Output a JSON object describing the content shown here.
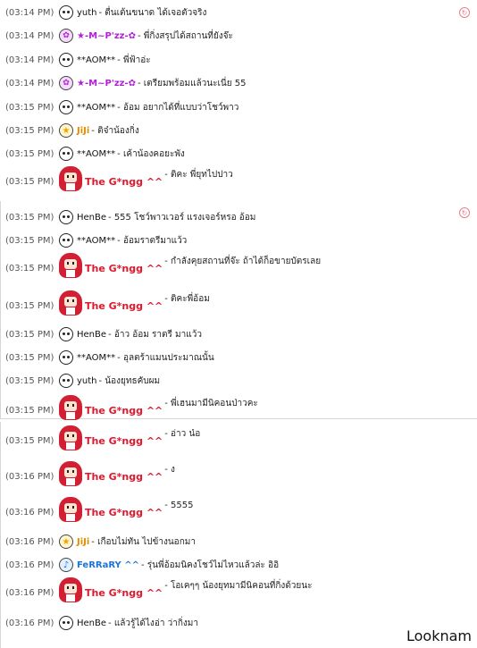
{
  "block1": [
    {
      "time": "(03:14 PM)",
      "avatar": "ghost-icon",
      "nick": "yuth",
      "style": "plain",
      "text": "- ตื่นเต้นขนาด ได้เจอตัวจริง"
    },
    {
      "time": "(03:14 PM)",
      "avatar": "flower-icon",
      "nick": "★-M~P'zz-✿",
      "style": "mopz",
      "text": "- พี่กิ่งสรุปได้สถานที่ยังจ๊ะ"
    },
    {
      "time": "(03:14 PM)",
      "avatar": "ghost-icon",
      "nick": "**AOM**",
      "style": "plain",
      "text": "- พี่ฟ้าอ่ะ"
    },
    {
      "time": "(03:14 PM)",
      "avatar": "flower-icon",
      "nick": "★-M~P'zz-✿",
      "style": "mopz",
      "text": "- เตรียมพร้อมแล้วนะเนี่ย 55"
    },
    {
      "time": "(03:15 PM)",
      "avatar": "ghost-icon",
      "nick": "**AOM**",
      "style": "plain",
      "text": "- อ้อม อยากได้ที่แบบว่าโชว์พาว"
    },
    {
      "time": "(03:15 PM)",
      "avatar": "star-icon",
      "nick": "JiJi",
      "style": "jiji",
      "text": "- ติจ๋าน้องกิ่ง"
    },
    {
      "time": "(03:15 PM)",
      "avatar": "ghost-icon",
      "nick": "**AOM**",
      "style": "plain",
      "text": "- เค้าน้องคอยะพัง"
    },
    {
      "time": "(03:15 PM)",
      "avatar": "red-hair-girl-icon",
      "nick": "The G*ngg ^^",
      "style": "gang",
      "text": "- ติคะ พี่ยุทไปปาว"
    }
  ],
  "block2": [
    {
      "time": "(03:15 PM)",
      "avatar": "ghost-icon",
      "nick": "HenBe",
      "style": "plain",
      "text": "- 555 โชว์พาวเวอร์ แรงเจอร์หรอ อ้อม"
    },
    {
      "time": "(03:15 PM)",
      "avatar": "ghost-icon",
      "nick": "**AOM**",
      "style": "plain",
      "text": "- อ้อมราตรีมาแว้ว"
    },
    {
      "time": "(03:15 PM)",
      "avatar": "red-hair-girl-icon",
      "nick": "The G*ngg ^^",
      "style": "gang",
      "text": "- กำลังคุยสถานที่จ๊ะ ถ้าได้ก็อขายบัตรเลย"
    },
    {
      "time": "(03:15 PM)",
      "avatar": "red-hair-girl-icon",
      "nick": "The G*ngg ^^",
      "style": "gang",
      "text": "- ติคะพี่อ้อม"
    },
    {
      "time": "(03:15 PM)",
      "avatar": "ghost-icon",
      "nick": "HenBe",
      "style": "plain",
      "text": "- อ้าว อ้อม ราตรี มาแว้ว"
    },
    {
      "time": "(03:15 PM)",
      "avatar": "ghost-icon",
      "nick": "**AOM**",
      "style": "plain",
      "text": "- อุลตร้าแมนประมาณนั้น"
    },
    {
      "time": "(03:15 PM)",
      "avatar": "ghost-icon",
      "nick": "yuth",
      "style": "plain",
      "text": "- น้องยุทธคับผม"
    },
    {
      "time": "(03:15 PM)",
      "avatar": "red-hair-girl-icon",
      "nick": "The G*ngg ^^",
      "style": "gang",
      "text": "- พี่เฮนมามีนิคอนป่าวคะ"
    }
  ],
  "block3": [
    {
      "time": "(03:15 PM)",
      "avatar": "red-hair-girl-icon",
      "nick": "The G*ngg ^^",
      "style": "gang",
      "text": "- อ่าว น๋อ"
    },
    {
      "time": "(03:16 PM)",
      "avatar": "red-hair-girl-icon",
      "nick": "The G*ngg ^^",
      "style": "gang",
      "text": "- ง"
    },
    {
      "time": "(03:16 PM)",
      "avatar": "red-hair-girl-icon",
      "nick": "The G*ngg ^^",
      "style": "gang",
      "text": "- 5555"
    },
    {
      "time": "(03:16 PM)",
      "avatar": "star-icon",
      "nick": "JiJi",
      "style": "jiji",
      "text": "- เกือบไม่ทัน ไปข้างนอกมา"
    },
    {
      "time": "(03:16 PM)",
      "avatar": "music-note-icon",
      "nick": "FeRRaRY ^^",
      "style": "ferr",
      "text": "- รุ่นพี่อ้อมนิคงโชว์ไม่ไหวแล้วล่ะ อิอิ"
    },
    {
      "time": "(03:16 PM)",
      "avatar": "red-hair-girl-icon",
      "nick": "The G*ngg ^^",
      "style": "gang",
      "text": "- โอเคๆๆ น้องยุทมามีนิคอนที่กิ่งด้วยนะ"
    },
    {
      "time": "(03:16 PM)",
      "avatar": "ghost-icon",
      "nick": "HenBe",
      "style": "plain",
      "text": "- แล้วรู้ได้ไงอ่า ว่ากิ่งมา"
    }
  ],
  "watermark": "Looknam"
}
